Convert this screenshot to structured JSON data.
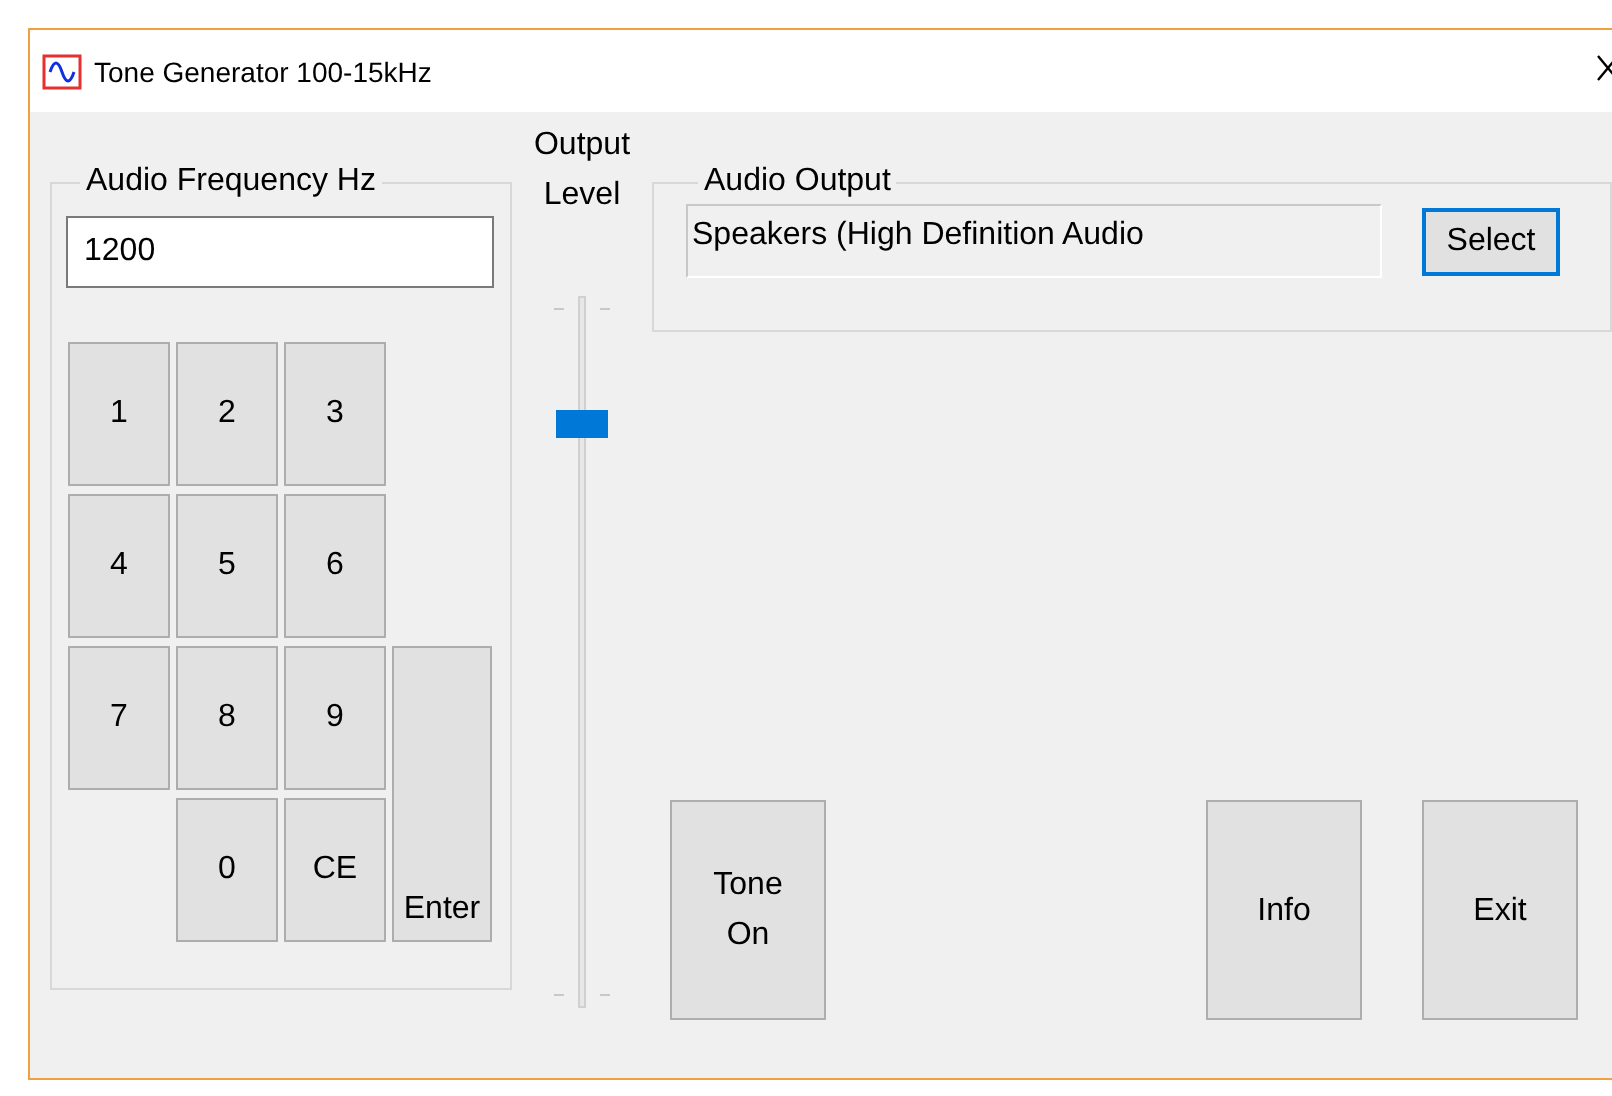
{
  "window": {
    "title": "Tone Generator 100-15kHz"
  },
  "frequency": {
    "label": "Audio Frequency Hz",
    "value": "1200",
    "keys": [
      {
        "label": "1",
        "kind": "key"
      },
      {
        "label": "2",
        "kind": "key"
      },
      {
        "label": "3",
        "kind": "key"
      },
      {
        "label": "4",
        "kind": "key"
      },
      {
        "label": "5",
        "kind": "key"
      },
      {
        "label": "6",
        "kind": "key"
      },
      {
        "label": "7",
        "kind": "key"
      },
      {
        "label": "8",
        "kind": "key"
      },
      {
        "label": "9",
        "kind": "key"
      },
      {
        "label": "0",
        "kind": "key"
      },
      {
        "label": "CE",
        "kind": "key"
      },
      {
        "label": "Enter",
        "kind": "enter"
      }
    ]
  },
  "output_level": {
    "label": "Output Level",
    "level": 0.82
  },
  "audio_output": {
    "label": "Audio Output",
    "device": "Speakers (High Definition Audio",
    "button": {
      "label": "Select",
      "focused": true
    }
  },
  "buttons": [
    {
      "label": "Tone On"
    },
    {
      "label": "Info"
    },
    {
      "label": "Exit"
    }
  ]
}
